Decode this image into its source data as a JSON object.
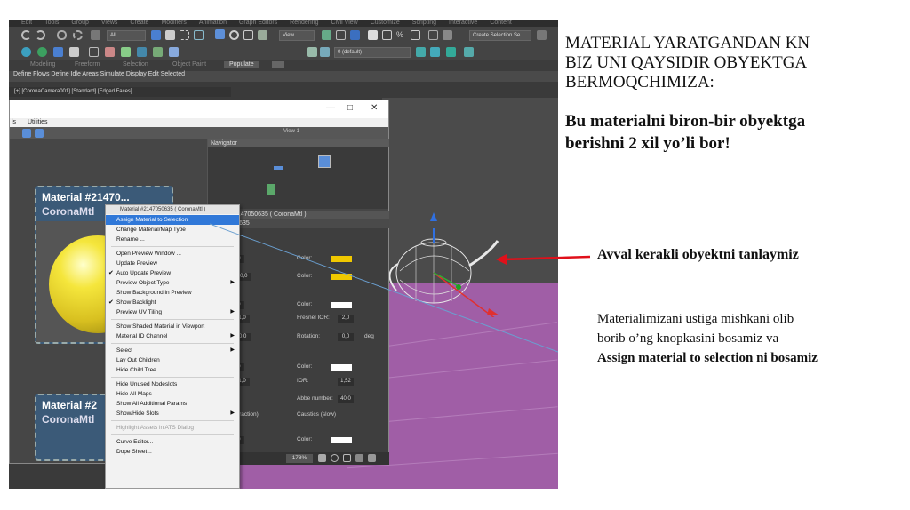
{
  "slide": {
    "heading_lines": [
      "MATERIAL YARATGANDAN KN",
      "BIZ UNI QAYSIDIR OBYEKTGA",
      "BERMOQCHIMIZA:"
    ],
    "heading_bold_lines": [
      "Bu materialni biron-bir obyektga",
      "berishni 2 xil yo’li bor!"
    ],
    "step1": "Avval kerakli obyektni tanlaymiz",
    "step2_lines": [
      "Materialimizani ustiga mishkani olib",
      "borib  o’ng knopkasini bosamiz va"
    ],
    "step2_bold": "Assign material to selection ni bosamiz",
    "colors": {
      "arrow_red": "#e0101a",
      "pointer_line": "#6a9fd0"
    }
  },
  "app": {
    "menubar": [
      "Edit",
      "Tools",
      "Group",
      "Views",
      "Create",
      "Modifiers",
      "Animation",
      "Graph Editors",
      "Rendering",
      "Civil View",
      "Customize",
      "Scripting",
      "Interactive",
      "Content"
    ],
    "toolbar": {
      "filter_value": "All",
      "view_value": "View",
      "selection_set": "Create Selection Se",
      "layer_value": "0 (default)"
    },
    "ribbon_tabs": [
      "Modeling",
      "Freeform",
      "Selection",
      "Object Paint",
      "Populate"
    ],
    "ribbon_active": "Populate",
    "ribbon_row": "Define Flows   Define Idle Areas   Simulate   Display   Edit Selected",
    "viewport_label": "[+] [CoronaCamera001] [Standard] [Edged Faces]"
  },
  "material_editor": {
    "menu": [
      "ls",
      "Utilities"
    ],
    "view_tab": "View 1",
    "navigator_title": "Navigator",
    "node1": {
      "title": "Material #21470...",
      "subtitle": "CoronaMtl"
    },
    "node2": {
      "title": "Material #2",
      "subtitle": "CoronaMtl"
    },
    "params_header": "aterial #2147050635  ( CoronaMtl )",
    "params_subheader": "#2147050635",
    "params": {
      "options_label": "options",
      "rows": [
        {
          "label": "Level:",
          "value": "1,0",
          "color_label": "Color:"
        },
        {
          "label": "lucency",
          "value": "",
          "color_label": ""
        },
        {
          "label": "Fraction:",
          "value": "0,0",
          "color_label": "Color:"
        },
        {
          "label": "ion",
          "value": "",
          "color_label": ""
        },
        {
          "label": "Level:",
          "value": "1,0",
          "color_label": "Color:"
        },
        {
          "label": "ssiness:",
          "value": "1,0",
          "color_label": "Fresnel IOR:",
          "extra": "2,0"
        },
        {
          "label": "ropy",
          "value": "",
          "color_label": ""
        },
        {
          "label": "Amount:",
          "value": "0,0",
          "color_label": "Rotation:",
          "extra": "0,0",
          "unit": "deg"
        },
        {
          "label": "on",
          "value": "",
          "color_label": ""
        },
        {
          "label": "Level:",
          "value": "0,0",
          "color_label": "Color:"
        },
        {
          "label": "ssiness:",
          "value": "1,0",
          "color_label": "IOR:",
          "extra": "1,52"
        },
        {
          "label": "sion",
          "value": "",
          "color_label": ""
        },
        {
          "label": "nabled",
          "value": "",
          "color_label": "Abbe number:",
          "extra": "40,0"
        },
        {
          "label": "thin (no refraction)",
          "value": "",
          "color_label": "Caustics (slow)"
        },
        {
          "label": "Level:",
          "value": "1,0",
          "color_label": "Color:"
        }
      ],
      "swatch_colors": [
        "#f0c800",
        "#f0c800",
        "#ffffff",
        "#ffffff",
        "#ffffff"
      ]
    },
    "zoom": "178%"
  },
  "context_menu": {
    "header": "Material #2147050635  ( CoronaMtl )",
    "items": [
      {
        "label": "Assign Material to Selection",
        "highlighted": true
      },
      {
        "label": "Change Material/Map Type"
      },
      {
        "label": "Rename ..."
      },
      {
        "sep": true
      },
      {
        "label": "Open Preview Window ..."
      },
      {
        "label": "Update Preview"
      },
      {
        "label": "Auto Update Preview",
        "checked": true
      },
      {
        "label": "Preview Object Type",
        "submenu": true
      },
      {
        "label": "Show Background in Preview"
      },
      {
        "label": "Show Backlight",
        "checked": true
      },
      {
        "label": "Preview UV Tiling",
        "submenu": true
      },
      {
        "sep": true
      },
      {
        "label": "Show Shaded Material in Viewport"
      },
      {
        "label": "Material ID Channel",
        "submenu": true
      },
      {
        "sep": true
      },
      {
        "label": "Select",
        "submenu": true
      },
      {
        "label": "Lay Out Children"
      },
      {
        "label": "Hide Child Tree"
      },
      {
        "sep": true
      },
      {
        "label": "Hide Unused Nodeslots"
      },
      {
        "label": "Hide All Maps"
      },
      {
        "label": "Show All Additional Params"
      },
      {
        "label": "Show/Hide Slots",
        "submenu": true
      },
      {
        "sep": true
      },
      {
        "label": "Highlight Assets in ATS Dialog",
        "disabled": true
      },
      {
        "sep": true
      },
      {
        "label": "Curve Editor..."
      },
      {
        "label": "Dope Sheet..."
      }
    ]
  }
}
